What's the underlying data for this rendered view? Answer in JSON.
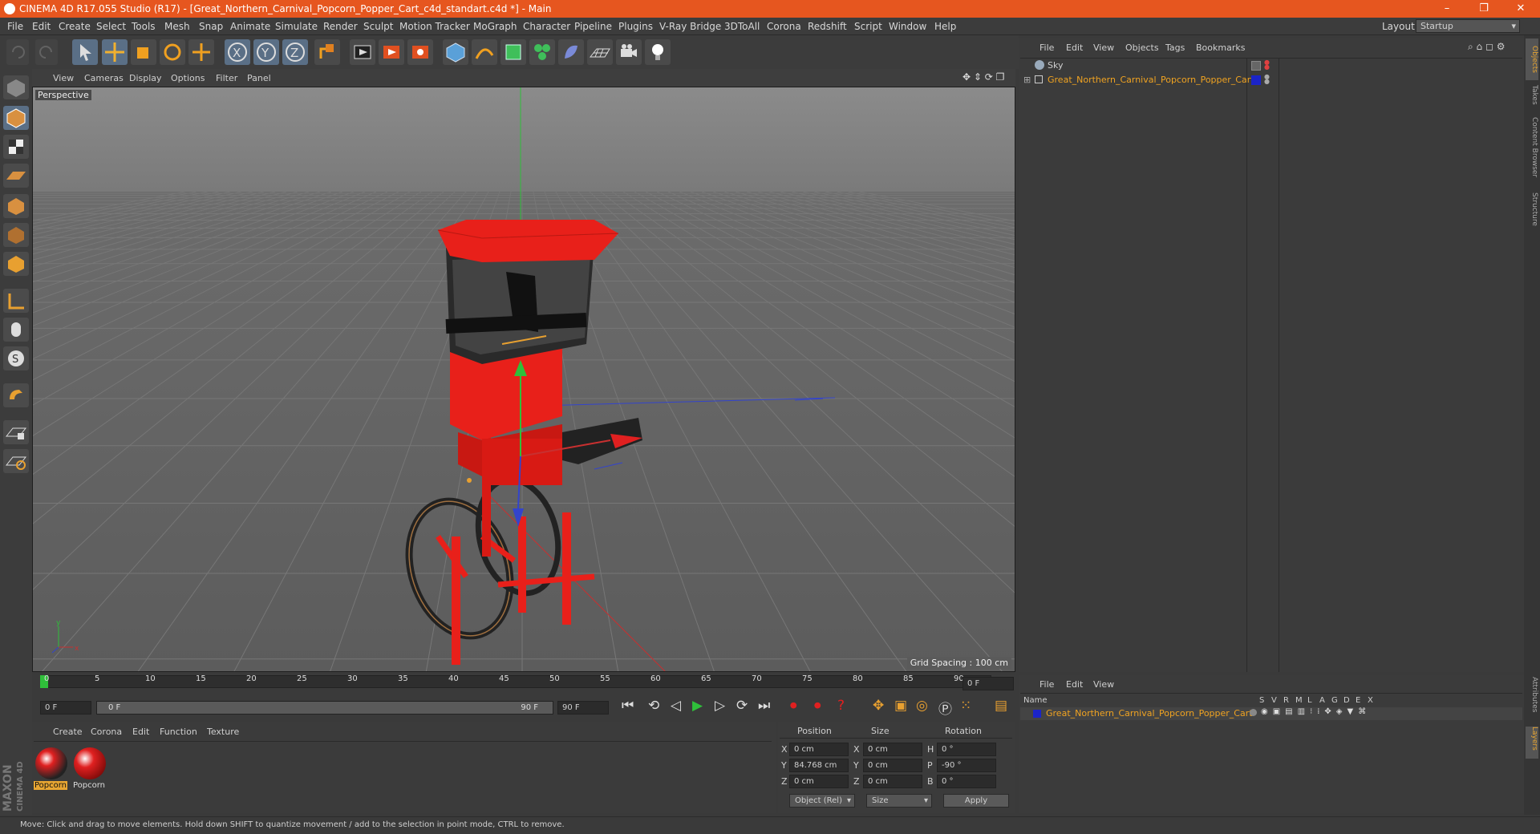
{
  "window": {
    "title": "CINEMA 4D R17.055 Studio (R17) - [Great_Northern_Carnival_Popcorn_Popper_Cart_c4d_standart.c4d *] - Main"
  },
  "menu": [
    "File",
    "Edit",
    "Create",
    "Select",
    "Tools",
    "Mesh",
    "Snap",
    "Animate",
    "Simulate",
    "Render",
    "Sculpt",
    "Motion Tracker",
    "MoGraph",
    "Character",
    "Pipeline",
    "Plugins",
    "V-Ray Bridge",
    "3DToAll",
    "Corona",
    "Redshift",
    "Script",
    "Window",
    "Help"
  ],
  "layout": {
    "label": "Layout:",
    "value": "Startup"
  },
  "viewport": {
    "menu": [
      "View",
      "Cameras",
      "Display",
      "Options",
      "Filter",
      "Panel"
    ],
    "camera_label": "Perspective",
    "grid_spacing": "Grid Spacing : 100 cm"
  },
  "timeline": {
    "ticks": [
      "0",
      "5",
      "10",
      "15",
      "20",
      "25",
      "30",
      "35",
      "40",
      "45",
      "50",
      "55",
      "60",
      "65",
      "70",
      "75",
      "80",
      "85",
      "90"
    ],
    "current_frame": "0 F",
    "start_field": "0 F",
    "range_start": "0 F",
    "range_end": "90 F",
    "end_field": "90 F"
  },
  "materials": {
    "menu": [
      "Create",
      "Corona",
      "Edit",
      "Function",
      "Texture"
    ],
    "items": [
      {
        "name": "Popcorn"
      },
      {
        "name": "Popcorn"
      }
    ]
  },
  "coordinates": {
    "headers": [
      "Position",
      "Size",
      "Rotation"
    ],
    "rows": [
      {
        "axis": "X",
        "pos": "0 cm",
        "size_axis": "X",
        "size": "0 cm",
        "rot_axis": "H",
        "rot": "0 °"
      },
      {
        "axis": "Y",
        "pos": "84.768 cm",
        "size_axis": "Y",
        "size": "0 cm",
        "rot_axis": "P",
        "rot": "-90 °"
      },
      {
        "axis": "Z",
        "pos": "0 cm",
        "size_axis": "Z",
        "size": "0 cm",
        "rot_axis": "B",
        "rot": "0 °"
      }
    ],
    "mode": "Object (Rel)",
    "size_mode": "Size",
    "apply": "Apply"
  },
  "object_manager": {
    "menu": [
      "File",
      "Edit",
      "View",
      "Objects",
      "Tags",
      "Bookmarks"
    ],
    "objects": [
      {
        "name": "Sky",
        "selected": false
      },
      {
        "name": "Great_Northern_Carnival_Popcorn_Popper_Cart",
        "selected": true
      }
    ]
  },
  "layer_manager": {
    "menu": [
      "File",
      "Edit",
      "View"
    ],
    "header_name": "Name",
    "columns": [
      "S",
      "V",
      "R",
      "M",
      "L",
      "A",
      "G",
      "D",
      "E",
      "X"
    ],
    "layers": [
      {
        "name": "Great_Northern_Carnival_Popcorn_Popper_Cart"
      }
    ]
  },
  "right_tabs": [
    "Objects",
    "Takes",
    "Content Browser",
    "Structure",
    "Attributes",
    "Layers"
  ],
  "status": "Move: Click and drag to move elements. Hold down SHIFT to quantize movement / add to the selection in point mode, CTRL to remove.",
  "brand": {
    "line1": "MAXON",
    "line2": "CINEMA 4D"
  },
  "colors": {
    "titlebar": "#e6561f",
    "accent": "#e8a632",
    "selected_text": "#f0a321",
    "cart_red": "#e8201a"
  }
}
